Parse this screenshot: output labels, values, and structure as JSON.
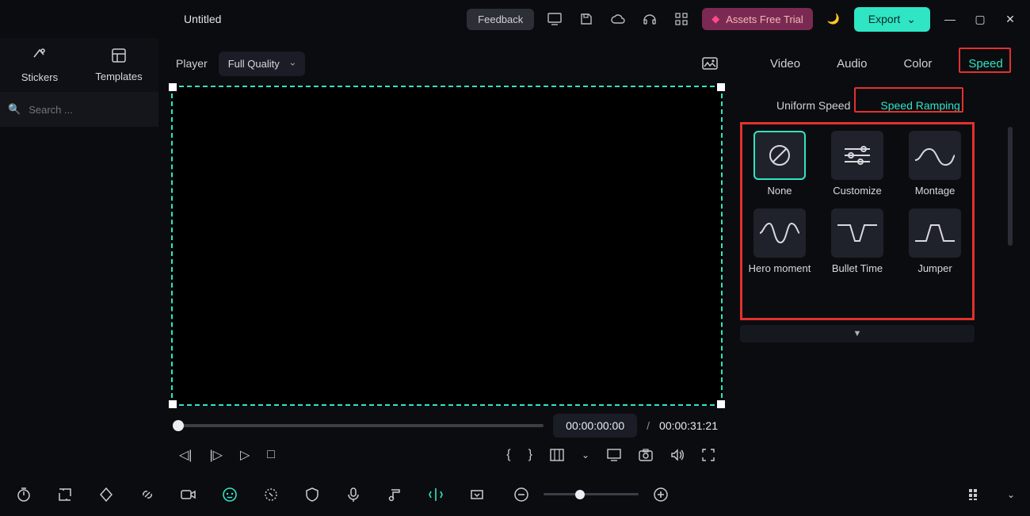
{
  "titlebar": {
    "filename": "Untitled",
    "feedback": "Feedback",
    "assets_trial": "Assets Free Trial",
    "export": "Export"
  },
  "library": {
    "tabs": [
      "Stickers",
      "Templates"
    ],
    "search_placeholder": "Search ..."
  },
  "player": {
    "label": "Player",
    "quality": "Full Quality",
    "current_time": "00:00:00:00",
    "duration": "00:00:31:21",
    "separator": "/"
  },
  "property_tabs": [
    "Video",
    "Audio",
    "Color",
    "Speed"
  ],
  "property_tab_active": "Speed",
  "speed_subtabs": [
    "Uniform Speed",
    "Speed Ramping"
  ],
  "speed_subtab_active": "Speed Ramping",
  "presets": [
    "None",
    "Customize",
    "Montage",
    "Hero moment",
    "Bullet Time",
    "Jumper"
  ],
  "colors": {
    "accent": "#2fe5c4",
    "highlight": "#e2312d"
  },
  "curly_open": "{",
  "curly_close": "}"
}
